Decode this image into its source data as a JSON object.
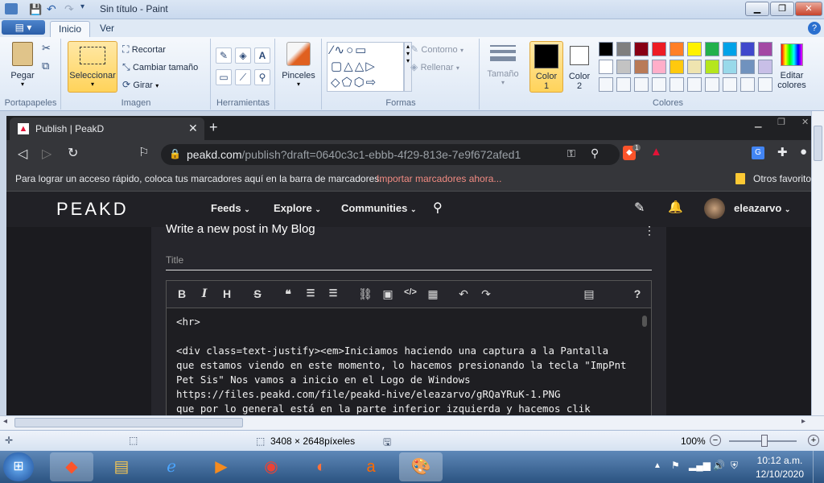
{
  "paint": {
    "title": "Sin título - Paint",
    "tabs": [
      "Inicio",
      "Ver"
    ],
    "groups": {
      "portapapeles": "Portapapeles",
      "imagen": "Imagen",
      "herramientas": "Herramientas",
      "formas": "Formas",
      "colores": "Colores"
    },
    "buttons": {
      "pegar": "Pegar",
      "seleccionar": "Seleccionar",
      "recortar": "Recortar",
      "cambiar_tamano": "Cambiar tamaño",
      "girar": "Girar",
      "pinceles": "Pinceles",
      "contorno": "Contorno",
      "rellenar": "Rellenar",
      "tamano": "Tamaño",
      "color1": "Color",
      "color1_num": "1",
      "color2": "Color",
      "color2_num": "2",
      "editar_colores": "Editar colores"
    },
    "palette": [
      "#000000",
      "#7f7f7f",
      "#880015",
      "#ed1c24",
      "#ff7f27",
      "#fff200",
      "#22b14c",
      "#00a2e8",
      "#3f48cc",
      "#a349a4",
      "#ffffff",
      "#c3c3c3",
      "#b97a57",
      "#ffaec9",
      "#ffc90e",
      "#efe4b0",
      "#b5e61d",
      "#99d9ea",
      "#7092be",
      "#c8bfe7"
    ],
    "color1_value": "#000000",
    "color2_value": "#ffffff",
    "status": {
      "dimensions": "3408 × 2648píxeles",
      "zoom": "100%"
    }
  },
  "browser": {
    "tab_title": "Publish | PeakD",
    "url_domain": "peakd.com",
    "url_path": "/publish?draft=0640c3c1-ebbb-4f29-813e-7e9f672afed1",
    "bookmark_hint": "Para lograr un acceso rápido, coloca tus marcadores aquí en la barra de marcadores.",
    "bookmark_import": "Importar marcadores ahora...",
    "other_bookmarks": "Otros favorito",
    "brave_badge": "1"
  },
  "peakd": {
    "logo": "PEAKD",
    "nav": [
      "Feeds",
      "Explore",
      "Communities"
    ],
    "username": "eleazarvo",
    "write_heading": "Write a new post in My Blog",
    "title_placeholder": "Title",
    "editor_lines": [
      "<hr>",
      "",
      "<div class=text-justify><em>Iniciamos haciendo una captura a la Pantalla",
      "que estamos viendo en este momento, lo hacemos presionando la tecla \"ImpPnt",
      "Pet Sis\" Nos vamos a inicio en el Logo de Windows",
      "https://files.peakd.com/file/peakd-hive/eleazarvo/gRQaYRuK-1.PNG",
      "que por lo general está en la parte inferior izquierda y hacemos clik"
    ]
  },
  "taskbar": {
    "time": "10:12 a.m.",
    "date": "12/10/2020"
  }
}
